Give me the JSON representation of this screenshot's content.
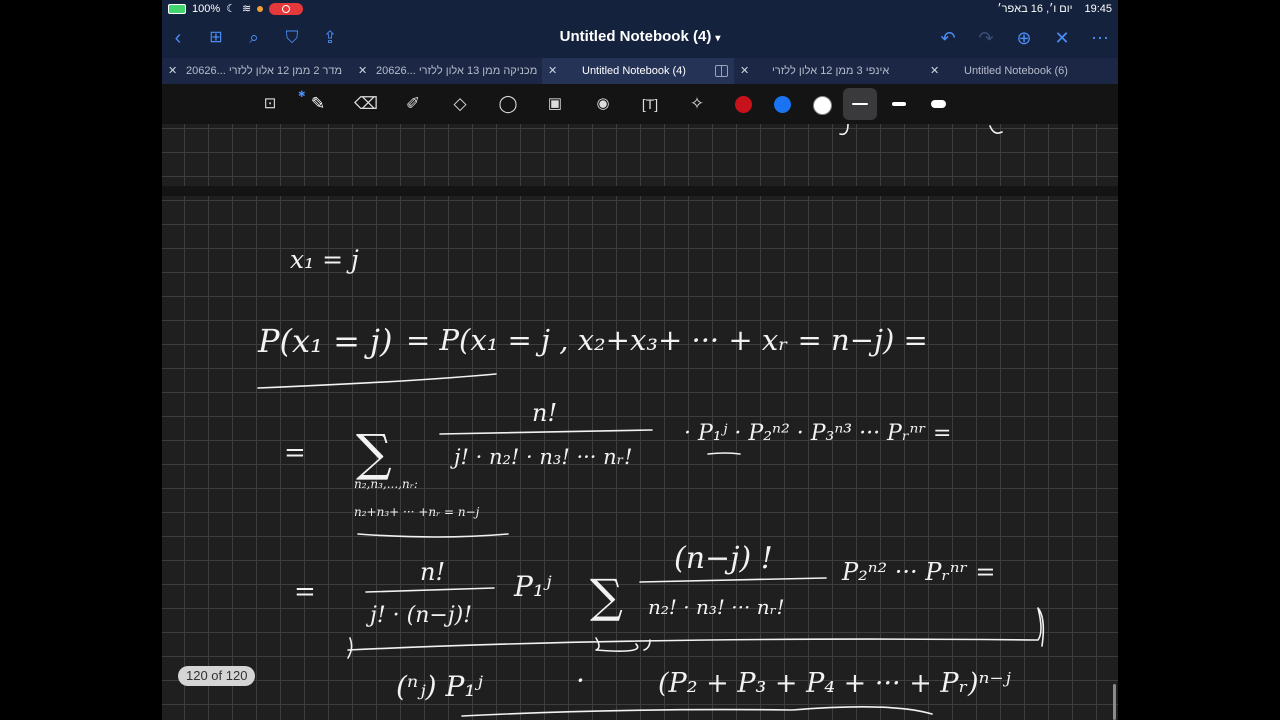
{
  "status": {
    "battery": "100%",
    "time": "19:45",
    "date": "יום ו׳, 16 באפר׳"
  },
  "nav": {
    "title": "Untitled Notebook (4)",
    "icons": [
      "back-icon",
      "grid-icon",
      "search-icon",
      "bookmark-icon",
      "share-icon",
      "undo-icon",
      "redo-icon",
      "add-page-icon",
      "close-icon",
      "more-icon"
    ]
  },
  "tabs": [
    {
      "label": "מדר 2 ממן 12 אלון ללזרי ...20626",
      "active": false
    },
    {
      "label": "מכניקה ממן 13 אלון ללזרי ...20626",
      "active": false
    },
    {
      "label": "Untitled Notebook (4)",
      "active": true
    },
    {
      "label": "אינפי 3 ממן 12 אלון ללזרי",
      "active": false
    },
    {
      "label": "Untitled Notebook (6)",
      "active": false
    }
  ],
  "toolbar": {
    "tools": [
      "shape-select-icon",
      "pen-icon",
      "eraser-icon",
      "highlighter-icon",
      "shapes-icon",
      "lasso-icon",
      "image-icon",
      "camera-icon",
      "text-icon",
      "laser-pointer-icon"
    ],
    "colors": [
      "#c8121b",
      "#1a73f0",
      "#ffffff"
    ]
  },
  "math": {
    "l1": "x₁ = j",
    "l2a": "P(x₁ = j)",
    "l2b": "= P(x₁ = j , x₂+x₃+ ··· + xᵣ = n−j) =",
    "l3eq": "=",
    "l3sum": "∑",
    "l3num": "n!",
    "l3den": "j! · n₂! · n₃! ··· nᵣ!",
    "l3rest": "· P₁ʲ · P₂ⁿ² · P₃ⁿ³ ··· Pᵣⁿʳ =",
    "l3sub1": "n₂,n₃,...,nᵣ:",
    "l3sub2": "n₂+n₃+ ··· +nᵣ = n−j",
    "l4eq": "=",
    "l4num": "n!",
    "l4den": "j! · (n−j)!",
    "l4p": "P₁ʲ",
    "l4sum": "∑",
    "l4num2": "(n−j) !",
    "l4den2": "n₂! · n₃! ··· nᵣ!",
    "l4rest": "P₂ⁿ² ··· Pᵣⁿʳ =",
    "l5binom": "(ⁿⱼ) P₁ʲ",
    "l5dot": "·",
    "l5rest": "(P₂ + P₃ + P₄ + ··· + Pᵣ)ⁿ⁻ʲ"
  },
  "page_indicator": "120 of 120"
}
